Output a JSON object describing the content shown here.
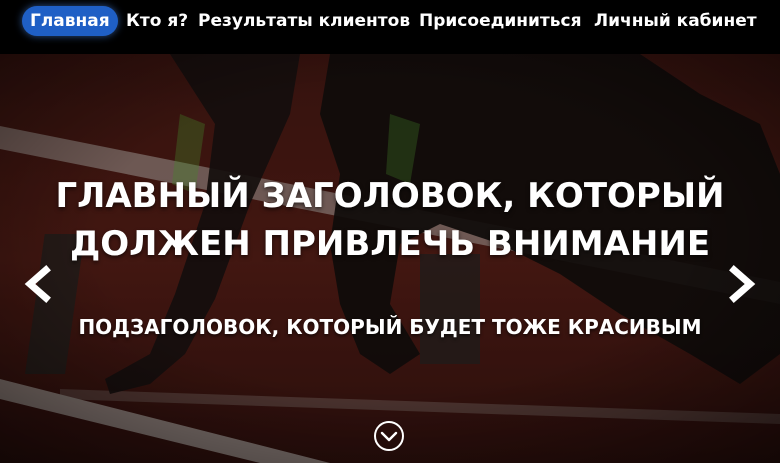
{
  "nav": {
    "items": [
      {
        "label": "Главная",
        "active": true
      },
      {
        "label": "Кто я?"
      },
      {
        "label": "Результаты клиентов"
      },
      {
        "label": "Присоединиться"
      },
      {
        "label": "Личный кабинет"
      }
    ]
  },
  "hero": {
    "headline_line1": "ГЛАВНЫЙ ЗАГОЛОВОК, КОТОРЫЙ",
    "headline_line2": "ДОЛЖЕН ПРИВЛЕЧЬ ВНИМАНИЕ",
    "subheadline": "ПОДЗАГОЛОВОК, КОТОРЫЙ БУДЕТ ТОЖЕ КРАСИВЫМ",
    "prev_icon": "chevron-left-icon",
    "next_icon": "chevron-right-icon",
    "scroll_icon": "chevron-down-circle-icon"
  },
  "colors": {
    "nav_bg": "#000000",
    "nav_active": "#1f5fc5",
    "track": "#5a1e16",
    "text": "#ffffff"
  }
}
